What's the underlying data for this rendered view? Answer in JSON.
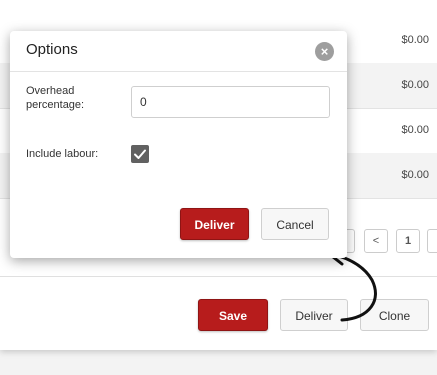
{
  "background": {
    "row_amounts": [
      "$0.00",
      "$0.00",
      "$0.00",
      "$0.00"
    ],
    "pagination": {
      "prev_symbol": "<",
      "current_page": "1"
    },
    "footer": {
      "save_label": "Save",
      "deliver_label": "Deliver",
      "clone_label": "Clone"
    }
  },
  "dialog": {
    "title": "Options",
    "close_symbol": "×",
    "overhead": {
      "label": "Overhead percentage:",
      "value": "0"
    },
    "include_labour": {
      "label": "Include labour:",
      "checked": true
    },
    "deliver_label": "Deliver",
    "cancel_label": "Cancel"
  },
  "colors": {
    "primary_red": "#b71c1c",
    "checkbox_fill": "#616161",
    "close_fill": "#9e9e9e"
  }
}
